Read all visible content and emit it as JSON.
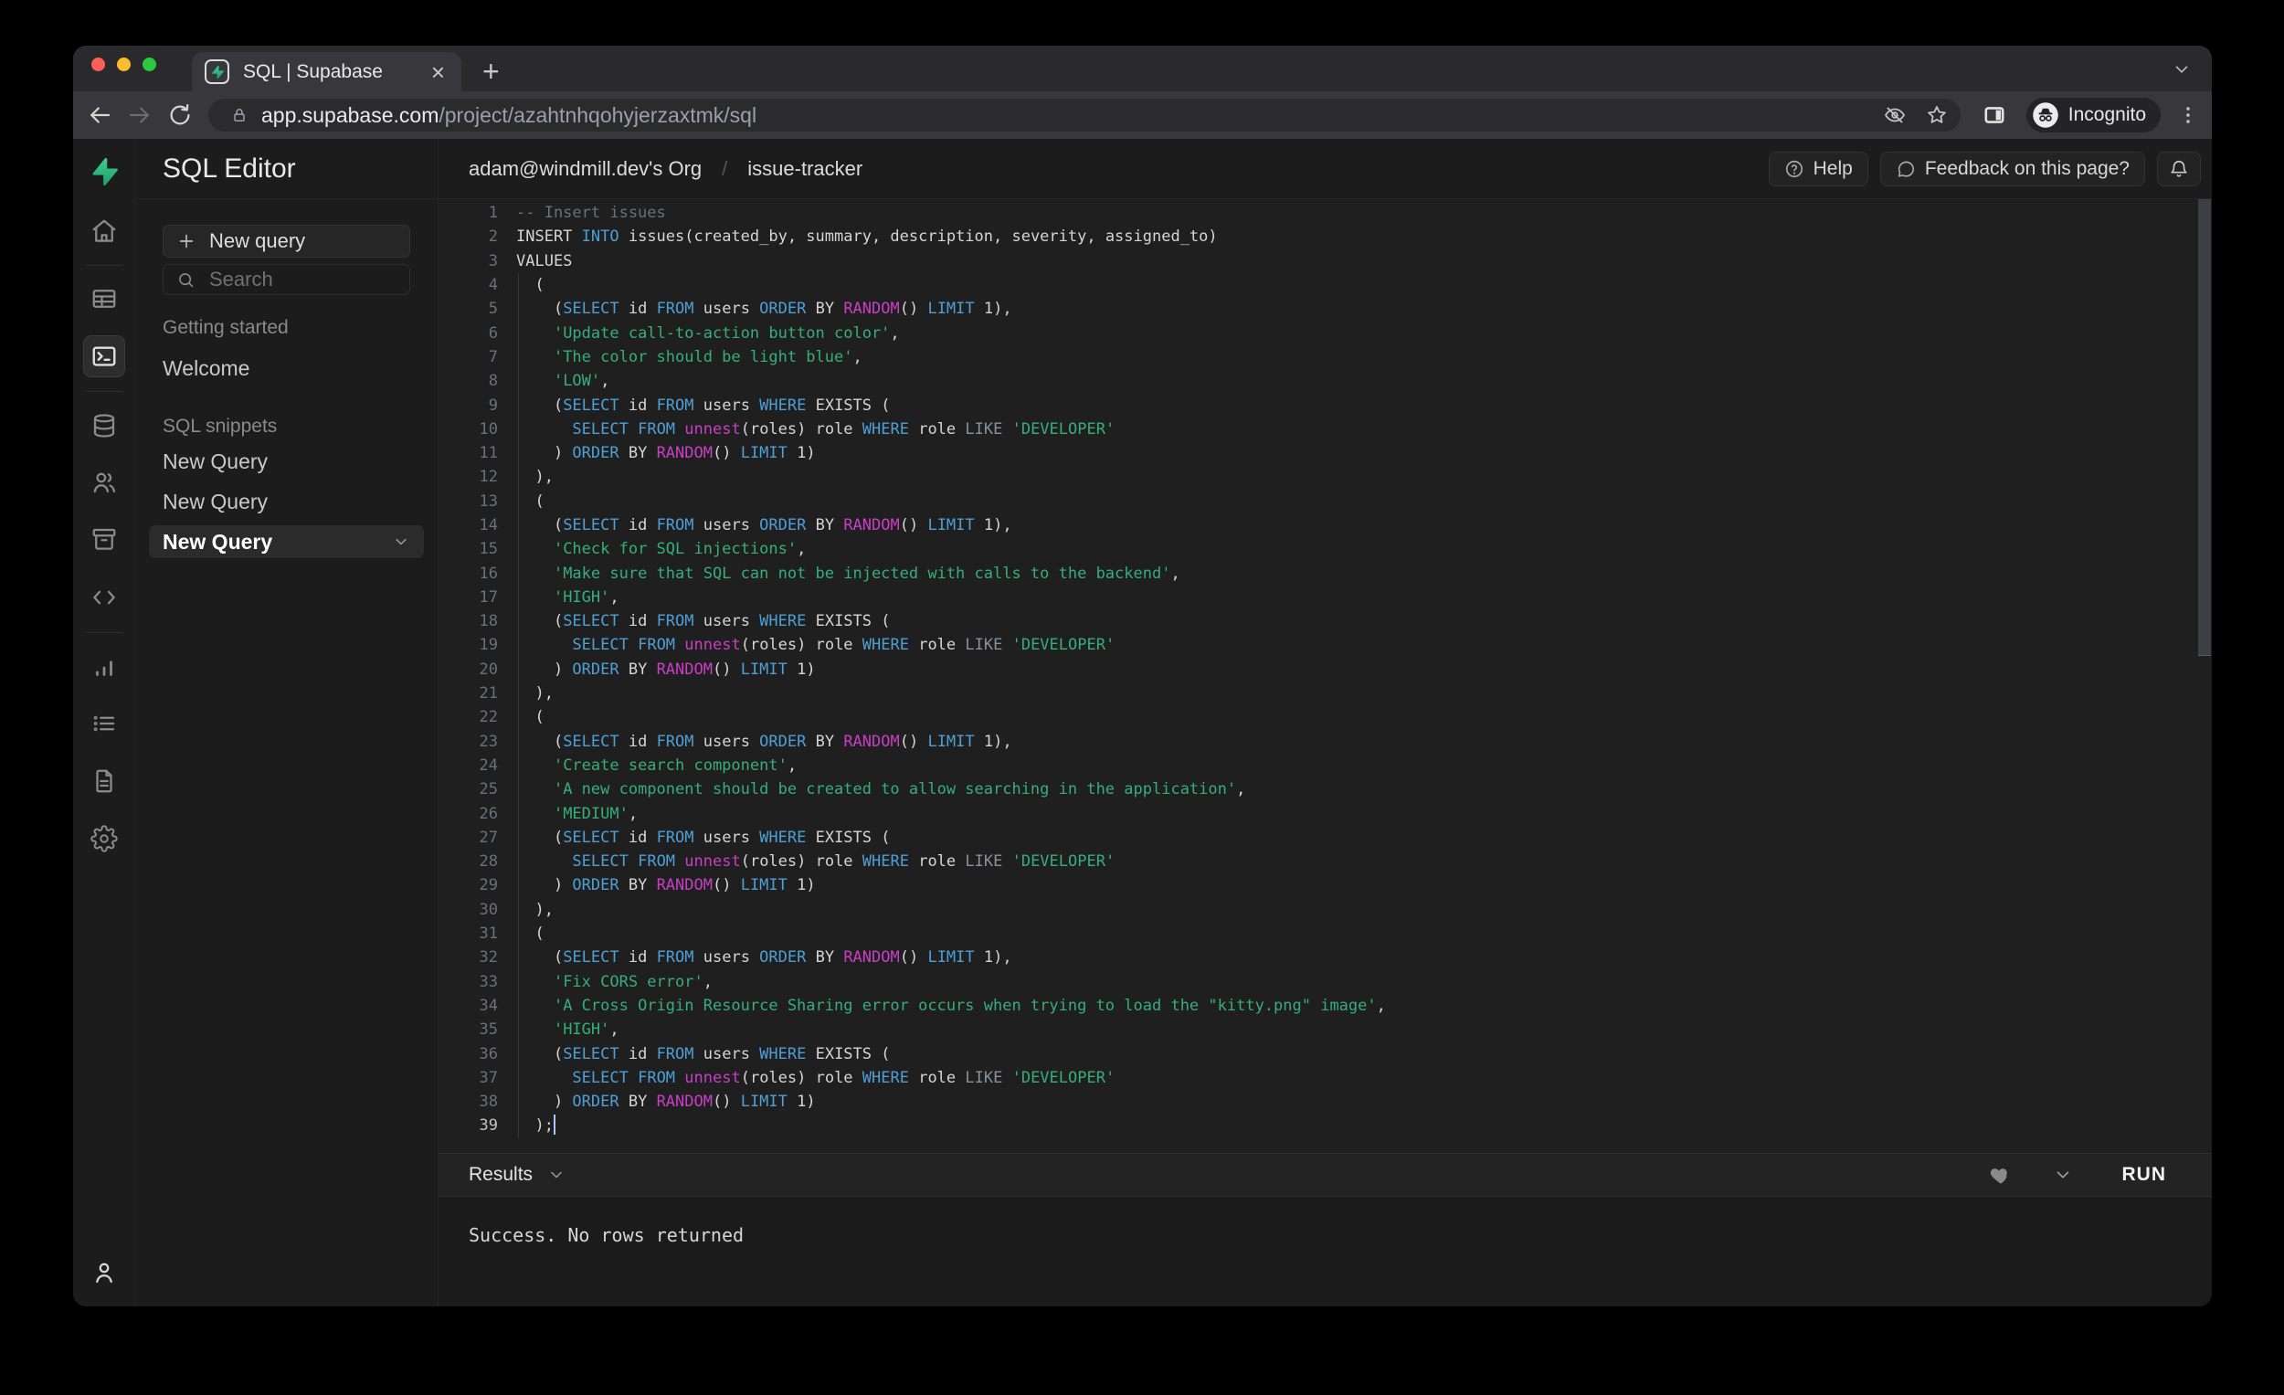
{
  "theme": {
    "accent": "#3ECF8E",
    "cursor": "#A8C7FA",
    "syntax": {
      "def": "#D5D5D5",
      "kw": "#4E9FD6",
      "fn": "#C93EC6",
      "str": "#36AD7D",
      "cmt": "#6B7177",
      "op": "#87929B"
    }
  },
  "browser": {
    "tab_title": "SQL | Supabase",
    "url_domain": "app.supabase.com",
    "url_path": "/project/azahtnhqohyjerzaxtmk/sql",
    "incognito_label": "Incognito"
  },
  "rail_icons": [
    "supabase-logo",
    "home",
    "table-editor",
    "sql-editor",
    "database",
    "authentication",
    "storage",
    "code",
    "reports",
    "logs",
    "api-docs",
    "settings",
    "account"
  ],
  "sidebar": {
    "title": "SQL Editor",
    "new_query_button": "New query",
    "search_placeholder": "Search",
    "getting_started_label": "Getting started",
    "welcome_label": "Welcome",
    "snippets_label": "SQL snippets",
    "snippets": [
      {
        "label": "New Query",
        "active": false
      },
      {
        "label": "New Query",
        "active": false
      },
      {
        "label": "New Query",
        "active": true
      }
    ]
  },
  "header": {
    "org": "adam@windmill.dev's Org",
    "separator": "/",
    "project": "issue-tracker",
    "help": "Help",
    "feedback": "Feedback on this page?"
  },
  "editor": {
    "cursor_line": 39,
    "lines": [
      [
        [
          "cmt",
          "-- Insert issues"
        ]
      ],
      [
        [
          "def",
          "INSERT "
        ],
        [
          "kw",
          "INTO"
        ],
        [
          "def",
          " issues(created_by, summary, description, severity, assigned_to)"
        ]
      ],
      [
        [
          "def",
          "VALUES"
        ]
      ],
      [
        [
          "def",
          "  ("
        ]
      ],
      [
        [
          "def",
          "    ("
        ],
        [
          "kw",
          "SELECT"
        ],
        [
          "def",
          " id "
        ],
        [
          "kw",
          "FROM"
        ],
        [
          "def",
          " users "
        ],
        [
          "kw",
          "ORDER"
        ],
        [
          "def",
          " BY "
        ],
        [
          "fn",
          "RANDOM"
        ],
        [
          "def",
          "() "
        ],
        [
          "kw",
          "LIMIT"
        ],
        [
          "def",
          " 1),"
        ]
      ],
      [
        [
          "def",
          "    "
        ],
        [
          "str",
          "'Update call-to-action button color'"
        ],
        [
          "def",
          ","
        ]
      ],
      [
        [
          "def",
          "    "
        ],
        [
          "str",
          "'The color should be light blue'"
        ],
        [
          "def",
          ","
        ]
      ],
      [
        [
          "def",
          "    "
        ],
        [
          "str",
          "'LOW'"
        ],
        [
          "def",
          ","
        ]
      ],
      [
        [
          "def",
          "    ("
        ],
        [
          "kw",
          "SELECT"
        ],
        [
          "def",
          " id "
        ],
        [
          "kw",
          "FROM"
        ],
        [
          "def",
          " users "
        ],
        [
          "kw",
          "WHERE"
        ],
        [
          "def",
          " EXISTS ("
        ]
      ],
      [
        [
          "def",
          "      "
        ],
        [
          "kw",
          "SELECT"
        ],
        [
          "def",
          " "
        ],
        [
          "kw",
          "FROM"
        ],
        [
          "def",
          " "
        ],
        [
          "fn",
          "unnest"
        ],
        [
          "def",
          "(roles) role "
        ],
        [
          "kw",
          "WHERE"
        ],
        [
          "def",
          " role "
        ],
        [
          "op",
          "LIKE"
        ],
        [
          "def",
          " "
        ],
        [
          "str",
          "'DEVELOPER'"
        ]
      ],
      [
        [
          "def",
          "    ) "
        ],
        [
          "kw",
          "ORDER"
        ],
        [
          "def",
          " BY "
        ],
        [
          "fn",
          "RANDOM"
        ],
        [
          "def",
          "() "
        ],
        [
          "kw",
          "LIMIT"
        ],
        [
          "def",
          " 1)"
        ]
      ],
      [
        [
          "def",
          "  ),"
        ]
      ],
      [
        [
          "def",
          "  ("
        ]
      ],
      [
        [
          "def",
          "    ("
        ],
        [
          "kw",
          "SELECT"
        ],
        [
          "def",
          " id "
        ],
        [
          "kw",
          "FROM"
        ],
        [
          "def",
          " users "
        ],
        [
          "kw",
          "ORDER"
        ],
        [
          "def",
          " BY "
        ],
        [
          "fn",
          "RANDOM"
        ],
        [
          "def",
          "() "
        ],
        [
          "kw",
          "LIMIT"
        ],
        [
          "def",
          " 1),"
        ]
      ],
      [
        [
          "def",
          "    "
        ],
        [
          "str",
          "'Check for SQL injections'"
        ],
        [
          "def",
          ","
        ]
      ],
      [
        [
          "def",
          "    "
        ],
        [
          "str",
          "'Make sure that SQL can not be injected with calls to the backend'"
        ],
        [
          "def",
          ","
        ]
      ],
      [
        [
          "def",
          "    "
        ],
        [
          "str",
          "'HIGH'"
        ],
        [
          "def",
          ","
        ]
      ],
      [
        [
          "def",
          "    ("
        ],
        [
          "kw",
          "SELECT"
        ],
        [
          "def",
          " id "
        ],
        [
          "kw",
          "FROM"
        ],
        [
          "def",
          " users "
        ],
        [
          "kw",
          "WHERE"
        ],
        [
          "def",
          " EXISTS ("
        ]
      ],
      [
        [
          "def",
          "      "
        ],
        [
          "kw",
          "SELECT"
        ],
        [
          "def",
          " "
        ],
        [
          "kw",
          "FROM"
        ],
        [
          "def",
          " "
        ],
        [
          "fn",
          "unnest"
        ],
        [
          "def",
          "(roles) role "
        ],
        [
          "kw",
          "WHERE"
        ],
        [
          "def",
          " role "
        ],
        [
          "op",
          "LIKE"
        ],
        [
          "def",
          " "
        ],
        [
          "str",
          "'DEVELOPER'"
        ]
      ],
      [
        [
          "def",
          "    ) "
        ],
        [
          "kw",
          "ORDER"
        ],
        [
          "def",
          " BY "
        ],
        [
          "fn",
          "RANDOM"
        ],
        [
          "def",
          "() "
        ],
        [
          "kw",
          "LIMIT"
        ],
        [
          "def",
          " 1)"
        ]
      ],
      [
        [
          "def",
          "  ),"
        ]
      ],
      [
        [
          "def",
          "  ("
        ]
      ],
      [
        [
          "def",
          "    ("
        ],
        [
          "kw",
          "SELECT"
        ],
        [
          "def",
          " id "
        ],
        [
          "kw",
          "FROM"
        ],
        [
          "def",
          " users "
        ],
        [
          "kw",
          "ORDER"
        ],
        [
          "def",
          " BY "
        ],
        [
          "fn",
          "RANDOM"
        ],
        [
          "def",
          "() "
        ],
        [
          "kw",
          "LIMIT"
        ],
        [
          "def",
          " 1),"
        ]
      ],
      [
        [
          "def",
          "    "
        ],
        [
          "str",
          "'Create search component'"
        ],
        [
          "def",
          ","
        ]
      ],
      [
        [
          "def",
          "    "
        ],
        [
          "str",
          "'A new component should be created to allow searching in the application'"
        ],
        [
          "def",
          ","
        ]
      ],
      [
        [
          "def",
          "    "
        ],
        [
          "str",
          "'MEDIUM'"
        ],
        [
          "def",
          ","
        ]
      ],
      [
        [
          "def",
          "    ("
        ],
        [
          "kw",
          "SELECT"
        ],
        [
          "def",
          " id "
        ],
        [
          "kw",
          "FROM"
        ],
        [
          "def",
          " users "
        ],
        [
          "kw",
          "WHERE"
        ],
        [
          "def",
          " EXISTS ("
        ]
      ],
      [
        [
          "def",
          "      "
        ],
        [
          "kw",
          "SELECT"
        ],
        [
          "def",
          " "
        ],
        [
          "kw",
          "FROM"
        ],
        [
          "def",
          " "
        ],
        [
          "fn",
          "unnest"
        ],
        [
          "def",
          "(roles) role "
        ],
        [
          "kw",
          "WHERE"
        ],
        [
          "def",
          " role "
        ],
        [
          "op",
          "LIKE"
        ],
        [
          "def",
          " "
        ],
        [
          "str",
          "'DEVELOPER'"
        ]
      ],
      [
        [
          "def",
          "    ) "
        ],
        [
          "kw",
          "ORDER"
        ],
        [
          "def",
          " BY "
        ],
        [
          "fn",
          "RANDOM"
        ],
        [
          "def",
          "() "
        ],
        [
          "kw",
          "LIMIT"
        ],
        [
          "def",
          " 1)"
        ]
      ],
      [
        [
          "def",
          "  ),"
        ]
      ],
      [
        [
          "def",
          "  ("
        ]
      ],
      [
        [
          "def",
          "    ("
        ],
        [
          "kw",
          "SELECT"
        ],
        [
          "def",
          " id "
        ],
        [
          "kw",
          "FROM"
        ],
        [
          "def",
          " users "
        ],
        [
          "kw",
          "ORDER"
        ],
        [
          "def",
          " BY "
        ],
        [
          "fn",
          "RANDOM"
        ],
        [
          "def",
          "() "
        ],
        [
          "kw",
          "LIMIT"
        ],
        [
          "def",
          " 1),"
        ]
      ],
      [
        [
          "def",
          "    "
        ],
        [
          "str",
          "'Fix CORS error'"
        ],
        [
          "def",
          ","
        ]
      ],
      [
        [
          "def",
          "    "
        ],
        [
          "str",
          "'A Cross Origin Resource Sharing error occurs when trying to load the \"kitty.png\" image'"
        ],
        [
          "def",
          ","
        ]
      ],
      [
        [
          "def",
          "    "
        ],
        [
          "str",
          "'HIGH'"
        ],
        [
          "def",
          ","
        ]
      ],
      [
        [
          "def",
          "    ("
        ],
        [
          "kw",
          "SELECT"
        ],
        [
          "def",
          " id "
        ],
        [
          "kw",
          "FROM"
        ],
        [
          "def",
          " users "
        ],
        [
          "kw",
          "WHERE"
        ],
        [
          "def",
          " EXISTS ("
        ]
      ],
      [
        [
          "def",
          "      "
        ],
        [
          "kw",
          "SELECT"
        ],
        [
          "def",
          " "
        ],
        [
          "kw",
          "FROM"
        ],
        [
          "def",
          " "
        ],
        [
          "fn",
          "unnest"
        ],
        [
          "def",
          "(roles) role "
        ],
        [
          "kw",
          "WHERE"
        ],
        [
          "def",
          " role "
        ],
        [
          "op",
          "LIKE"
        ],
        [
          "def",
          " "
        ],
        [
          "str",
          "'DEVELOPER'"
        ]
      ],
      [
        [
          "def",
          "    ) "
        ],
        [
          "kw",
          "ORDER"
        ],
        [
          "def",
          " BY "
        ],
        [
          "fn",
          "RANDOM"
        ],
        [
          "def",
          "() "
        ],
        [
          "kw",
          "LIMIT"
        ],
        [
          "def",
          " 1)"
        ]
      ],
      [
        [
          "def",
          "  );"
        ]
      ]
    ]
  },
  "results": {
    "label": "Results",
    "run": "RUN",
    "message": "Success. No rows returned"
  }
}
